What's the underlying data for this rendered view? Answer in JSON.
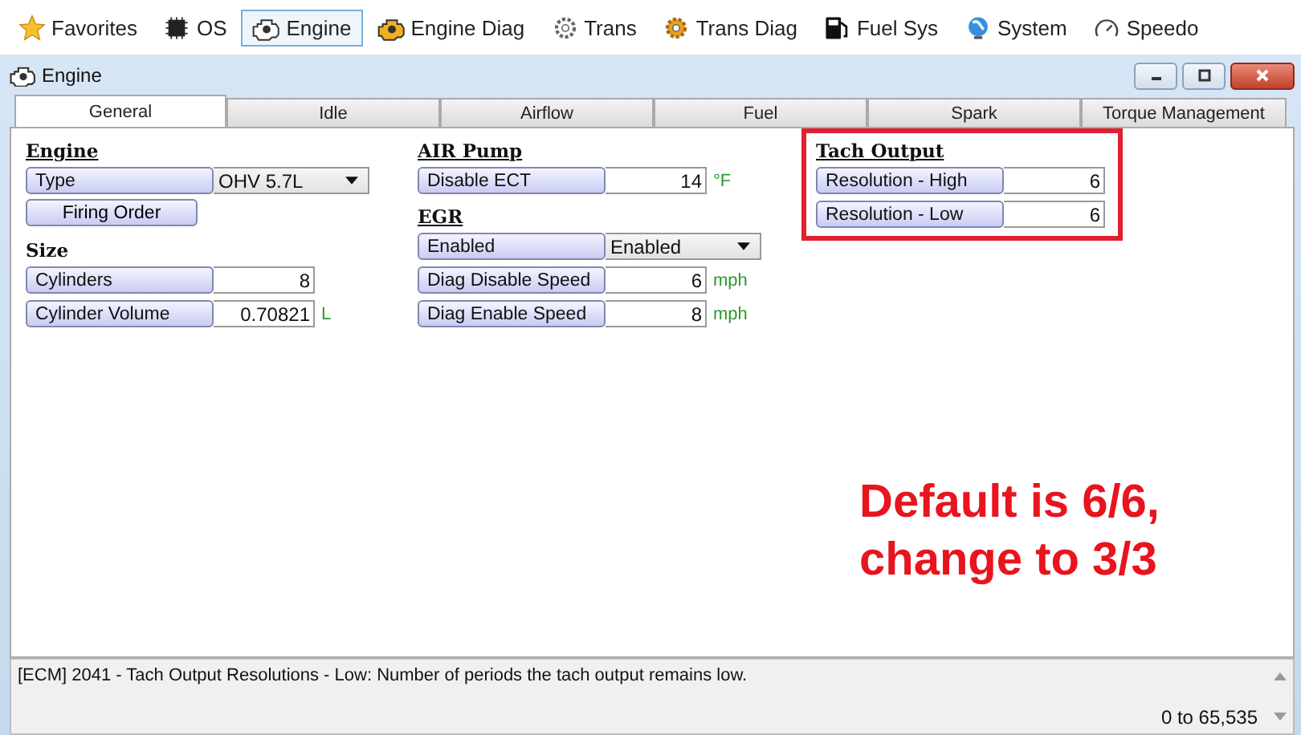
{
  "toolbar": [
    {
      "label": "Favorites",
      "selected": false
    },
    {
      "label": "OS",
      "selected": false
    },
    {
      "label": "Engine",
      "selected": true
    },
    {
      "label": "Engine Diag",
      "selected": false
    },
    {
      "label": "Trans",
      "selected": false
    },
    {
      "label": "Trans Diag",
      "selected": false
    },
    {
      "label": "Fuel Sys",
      "selected": false
    },
    {
      "label": "System",
      "selected": false
    },
    {
      "label": "Speedo",
      "selected": false
    }
  ],
  "window": {
    "title": "Engine"
  },
  "tabs": [
    {
      "label": "General",
      "selected": true
    },
    {
      "label": "Idle",
      "selected": false
    },
    {
      "label": "Airflow",
      "selected": false
    },
    {
      "label": "Fuel",
      "selected": false
    },
    {
      "label": "Spark",
      "selected": false
    },
    {
      "label": "Torque Management",
      "selected": false
    }
  ],
  "columns": [
    {
      "highlighted": false,
      "groups": [
        {
          "heading": "Engine",
          "underlined": true,
          "rows": [
            {
              "kind": "dropdown",
              "label": "Type",
              "value": "OHV 5.7L"
            },
            {
              "kind": "button",
              "label": "Firing Order"
            }
          ]
        },
        {
          "heading": "Size",
          "underlined": false,
          "rows": [
            {
              "kind": "field",
              "label": "Cylinders",
              "value": "8"
            },
            {
              "kind": "field",
              "label": "Cylinder Volume",
              "value": "0.70821",
              "unit": "L"
            }
          ]
        }
      ]
    },
    {
      "highlighted": false,
      "groups": [
        {
          "heading": "AIR Pump",
          "underlined": true,
          "rows": [
            {
              "kind": "field",
              "label": "Disable ECT",
              "value": "14",
              "unit": "°F"
            }
          ]
        },
        {
          "heading": "EGR",
          "underlined": true,
          "rows": [
            {
              "kind": "dropdown",
              "label": "Enabled",
              "value": "Enabled"
            },
            {
              "kind": "field",
              "label": "Diag Disable Speed",
              "value": "6",
              "unit": "mph"
            },
            {
              "kind": "field",
              "label": "Diag Enable Speed",
              "value": "8",
              "unit": "mph"
            }
          ]
        }
      ]
    },
    {
      "highlighted": true,
      "groups": [
        {
          "heading": "Tach Output",
          "underlined": true,
          "rows": [
            {
              "kind": "field",
              "label": "Resolution - High",
              "value": "6"
            },
            {
              "kind": "field",
              "label": "Resolution - Low",
              "value": "6"
            }
          ]
        }
      ]
    }
  ],
  "annotation": [
    "Default is 6/6,",
    "change to 3/3"
  ],
  "status": {
    "description": "[ECM] 2041 - Tach Output Resolutions - Low: Number of periods the tach output remains low.",
    "range": "0 to 65,535"
  }
}
